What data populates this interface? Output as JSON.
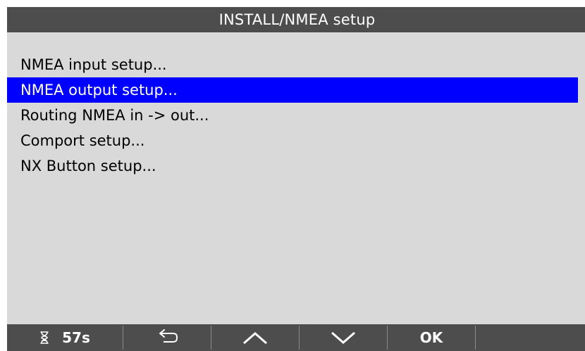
{
  "title": "INSTALL/NMEA setup",
  "menu": {
    "items": [
      {
        "label": "NMEA input setup..."
      },
      {
        "label": "NMEA output setup...",
        "selected": true
      },
      {
        "label": "Routing NMEA in -> out..."
      },
      {
        "label": "Comport setup..."
      },
      {
        "label": "NX Button setup..."
      }
    ]
  },
  "softkeys": {
    "timer_value": "57s",
    "timer_icon": "hourglass-icon",
    "back_icon": "back-arrow-icon",
    "up_icon": "chevron-up-icon",
    "down_icon": "chevron-down-icon",
    "ok_label": "OK"
  },
  "colors": {
    "screen_background": "#d9d9d9",
    "bar_background": "#4d4d4d",
    "selection_background": "#0000ff",
    "selection_text": "#ffffff",
    "text": "#000000"
  }
}
